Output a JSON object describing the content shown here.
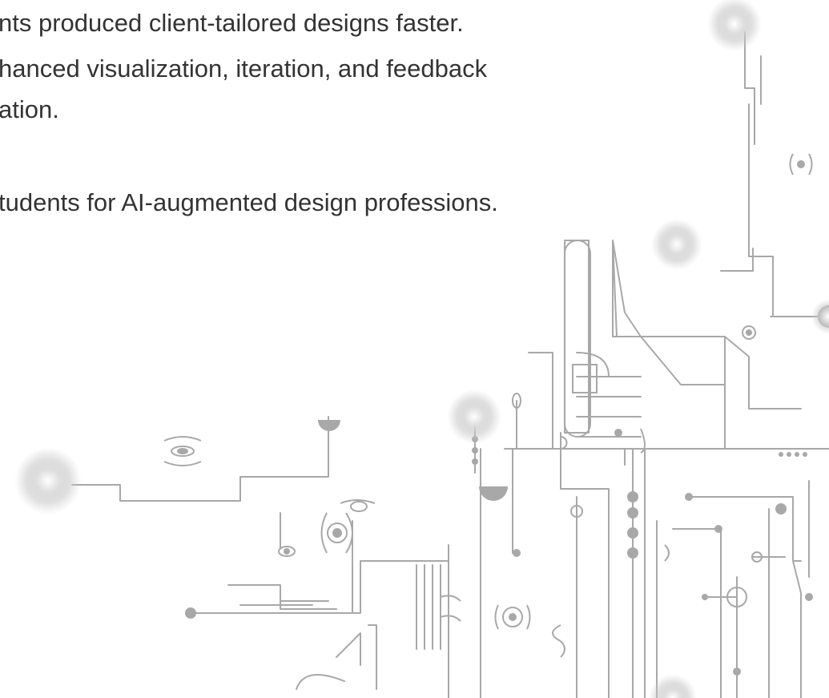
{
  "slide": {
    "lines": [
      "nts produced client-tailored designs faster.",
      "hanced visualization, iteration, and feedback",
      "ation.",
      "tudents for AI-augmented design professions."
    ]
  },
  "colors": {
    "text": "#333333",
    "circuit": "#a8a8a8",
    "background": "#ffffff"
  }
}
